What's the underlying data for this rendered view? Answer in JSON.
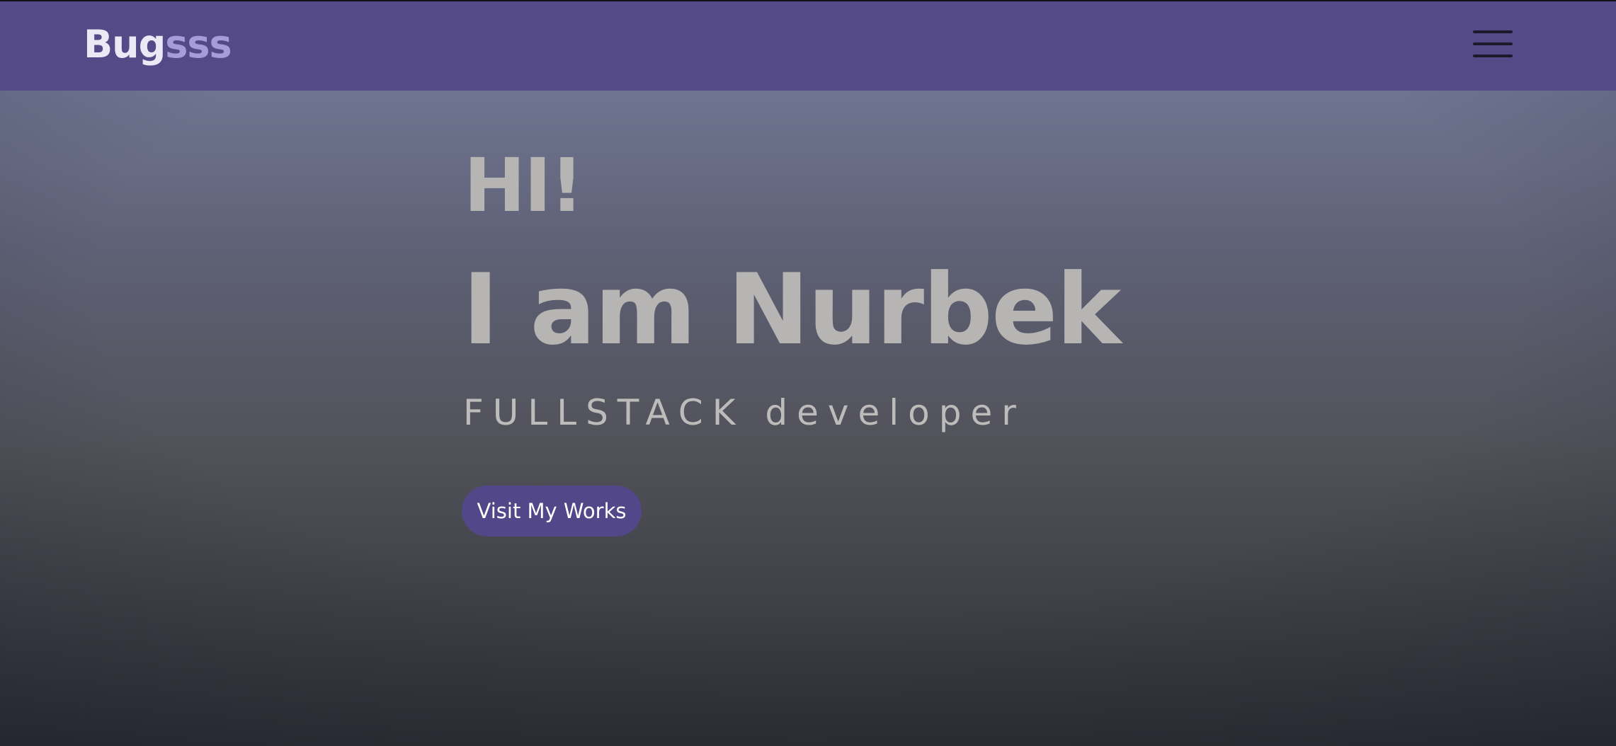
{
  "colors": {
    "navbar_bg": "#534a87",
    "accent": "#a79bd9",
    "button_bg": "#514789",
    "hero_text": "#b6b5b3"
  },
  "header": {
    "logo_main": "Bug",
    "logo_accent": "sss",
    "menu_icon": "hamburger-menu-icon"
  },
  "hero": {
    "greeting": "HI!",
    "headline": "I am Nurbek",
    "subtitle": "FULLSTACK developer",
    "cta_label": "Visit My Works"
  }
}
